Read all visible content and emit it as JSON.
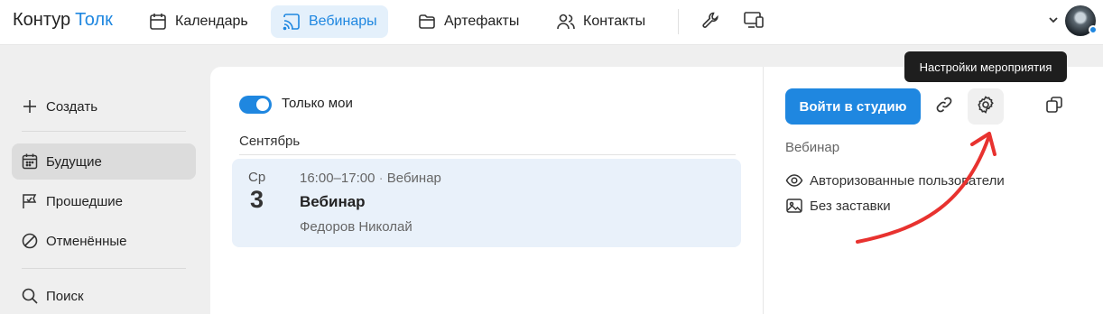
{
  "app": {
    "logo_part1": "Контур",
    "logo_part2": "Толк"
  },
  "nav": {
    "items": [
      {
        "label": "Календарь",
        "icon": "calendar-icon",
        "active": false
      },
      {
        "label": "Вебинары",
        "icon": "cast-icon",
        "active": true
      },
      {
        "label": "Артефакты",
        "icon": "folder-icon",
        "active": false
      },
      {
        "label": "Контакты",
        "icon": "contacts-icon",
        "active": false
      }
    ],
    "tools_icon": "wrench-icon",
    "devices_icon": "devices-icon"
  },
  "sidebar": {
    "create_label": "Создать",
    "items": [
      {
        "label": "Будущие",
        "icon": "calendar-grid-icon",
        "active": true
      },
      {
        "label": "Прошедшие",
        "icon": "flag-icon",
        "active": false
      },
      {
        "label": "Отменённые",
        "icon": "cancel-icon",
        "active": false
      }
    ],
    "search_label": "Поиск"
  },
  "list": {
    "toggle_label": "Только мои",
    "toggle_on": true,
    "month": "Сентябрь",
    "event": {
      "weekday": "Ср",
      "day": "3",
      "time": "16:00–17:00",
      "separator": "·",
      "type": "Вебинар",
      "title": "Вебинар",
      "host": "Федоров Николай"
    }
  },
  "details": {
    "join_label": "Войти в студию",
    "tooltip": "Настройки мероприятия",
    "kind": "Вебинар",
    "props": [
      {
        "label": "Авторизованные пользователи",
        "icon": "eye-icon"
      },
      {
        "label": "Без заставки",
        "icon": "image-icon"
      }
    ]
  },
  "colors": {
    "accent": "#1f87e0",
    "annotation": "#e8322f"
  }
}
